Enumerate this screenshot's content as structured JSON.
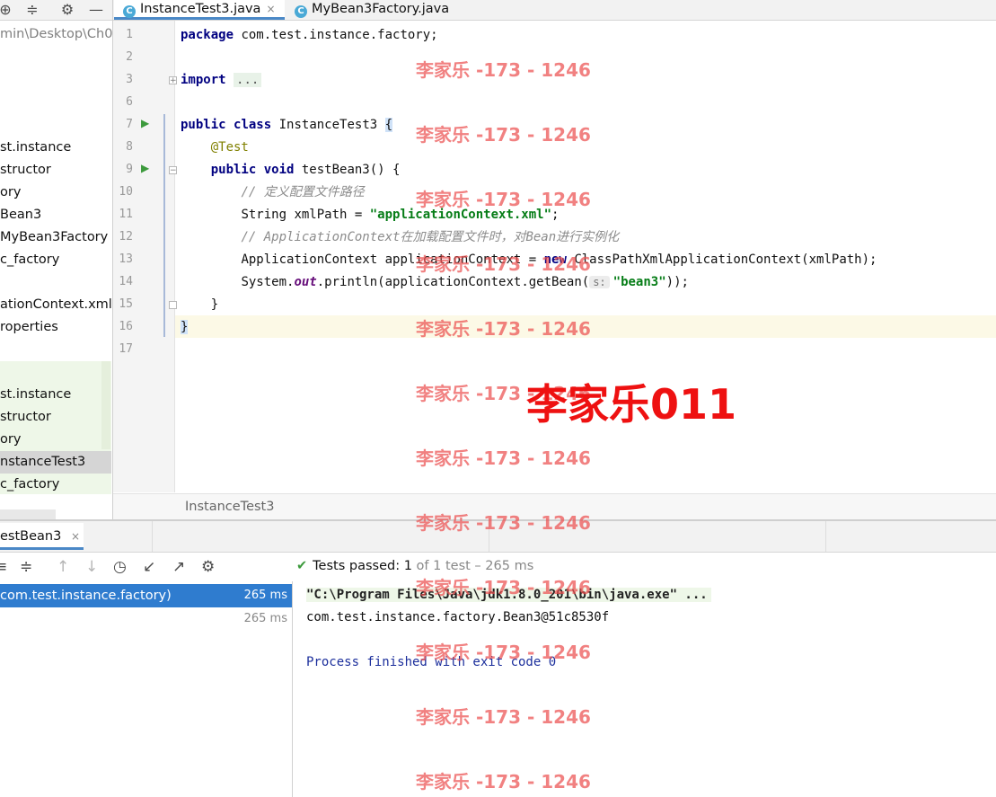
{
  "project_panel": {
    "path": "min\\Desktop\\Ch0",
    "items": [
      "st.instance",
      "structor",
      "ory",
      "Bean3",
      "MyBean3Factory",
      "c_factory",
      "ationContext.xml",
      "roperties"
    ],
    "items_lower": [
      "st.instance",
      "structor",
      "ory",
      "nstanceTest3",
      "c_factory"
    ]
  },
  "editor_tabs": [
    {
      "label": "InstanceTest3.java",
      "close": "×"
    },
    {
      "label": "MyBean3Factory.java"
    }
  ],
  "class_icon_letter": "C",
  "line_numbers": [
    "1",
    "2",
    "3",
    "6",
    "7",
    "8",
    "9",
    "10",
    "11",
    "12",
    "13",
    "14",
    "15",
    "16",
    "17"
  ],
  "code": {
    "l1_kw": "package",
    "l1_rest": " com.test.instance.factory;",
    "l3_kw": "import",
    "l3_fold": "...",
    "l7_kw1": "public",
    "l7_kw2": "class",
    "l7_name": " InstanceTest3 ",
    "l7_brace": "{",
    "l8_ann": "@Test",
    "l9_kw1": "public",
    "l9_kw2": "void",
    "l9_rest": " testBean3() {",
    "l10_cmt": "// 定义配置文件路径",
    "l11_a": "String xmlPath = ",
    "l11_str": "\"applicationContext.xml\"",
    "l11_b": ";",
    "l12_cmt": "// ApplicationContext在加载配置文件时，对Bean进行实例化",
    "l13_a": "ApplicationContext applicationContext = ",
    "l13_kw": "new",
    "l13_b": " ClassPathXmlApplicationContext(xmlPath);",
    "l14_a": "System.",
    "l14_fld": "out",
    "l14_b": ".println(applicationContext.getBean(",
    "l14_hint": "s:",
    "l14_str": "\"bean3\"",
    "l14_c": "));",
    "l15": "}",
    "l16": "}"
  },
  "breadcrumb": "InstanceTest3",
  "run_panel": {
    "tab_label": "estBean3",
    "tab_close": "×",
    "status_label": "Tests passed:",
    "status_count": "1",
    "status_detail": "of 1 test – 265 ms",
    "tree": [
      {
        "label": "com.test.instance.factory)",
        "time": "265 ms"
      },
      {
        "label": "",
        "time": "265 ms"
      }
    ],
    "console": [
      "\"C:\\Program Files\\Java\\jdk1.8.0_201\\bin\\java.exe\" ...",
      "com.test.instance.factory.Bean3@51c8530f",
      "Process finished with exit code 0"
    ]
  },
  "watermark_small": "李家乐 -173 - 1246",
  "watermark_big": "李家乐011"
}
